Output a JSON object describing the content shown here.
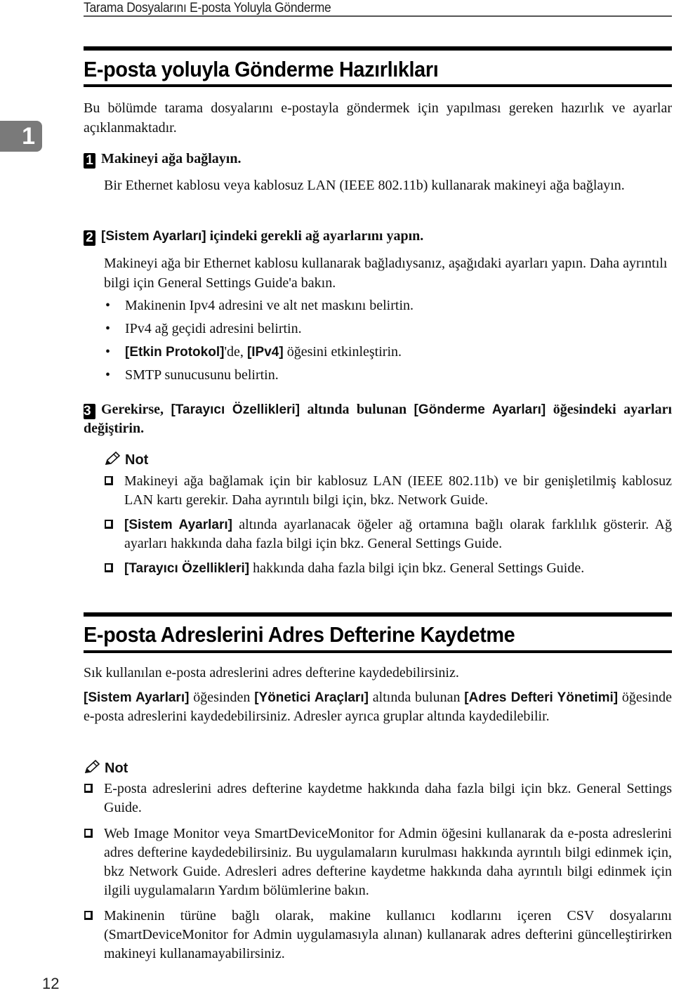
{
  "running_header": "Tarama Dosyalarını E-posta Yoluyla Gönderme",
  "chapter_tab": "1",
  "page_number": "12",
  "section1": {
    "title": "E-posta yoluyla Gönderme Hazırlıkları",
    "intro": "Bu bölümde tarama dosyalarını e-postayla göndermek için yapılması gereken hazırlık ve ayarlar açıklanmaktadır.",
    "steps": [
      {
        "number": "1",
        "heading": "Makineyi ağa bağlayın.",
        "body": "Bir Ethernet kablosu veya kablosuz LAN (IEEE 802.11b) kullanarak makineyi ağa bağlayın."
      },
      {
        "number": "2",
        "heading_key": "[Sistem Ayarları]",
        "heading_rest": " içindeki gerekli ağ ayarlarını yapın.",
        "body": "Makineyi ağa bir Ethernet kablosu kullanarak bağladıysanız, aşağıdaki ayarları yapın. Daha ayrıntılı bilgi için General Settings Guide'a bakın.",
        "bullets": [
          {
            "text": "Makinenin Ipv4 adresini ve alt net maskını belirtin."
          },
          {
            "text": "IPv4 ağ geçidi adresini belirtin."
          },
          {
            "key1": "[Etkin Protokol]",
            "mid": "'de, ",
            "key2": "[IPv4]",
            "rest": " öğesini etkinleştirin."
          },
          {
            "text": "SMTP sunucusunu belirtin."
          }
        ]
      },
      {
        "number": "3",
        "heading_pre": "Gerekirse, ",
        "heading_key1": "[Tarayıcı Özellikleri]",
        "heading_mid": " altında bulunan ",
        "heading_key2": "[Gönderme Ayarları]",
        "heading_rest": " öğesindeki ayarları değiştirin."
      }
    ],
    "note": {
      "title": "Not",
      "items": [
        {
          "text": "Makineyi ağa bağlamak için bir kablosuz LAN (IEEE 802.11b) ve bir genişletilmiş kablosuz LAN kartı gerekir. Daha ayrıntılı bilgi için, bkz. Network Guide."
        },
        {
          "key": "[Sistem Ayarları]",
          "text": " altında ayarlanacak öğeler ağ ortamına bağlı olarak farklılık gösterir. Ağ ayarları hakkında daha fazla bilgi için bkz. General Settings Guide."
        },
        {
          "key": "[Tarayıcı Özellikleri]",
          "text": " hakkında daha fazla bilgi için bkz. General Settings Guide."
        }
      ]
    }
  },
  "section2": {
    "title": "E-posta Adreslerini Adres Defterine Kaydetme",
    "intro": "Sık kullanılan e-posta adreslerini adres defterine kaydedebilirsiniz.",
    "para": {
      "key1": "[Sistem Ayarları]",
      "t1": " öğesinden ",
      "key2": "[Yönetici Araçları]",
      "t2": " altında bulunan ",
      "key3": "[Adres Defteri Yönetimi]",
      "t3": " öğesinde e-posta adreslerini kaydedebilirsiniz. Adresler ayrıca gruplar altında kaydedilebilir."
    },
    "note": {
      "title": "Not",
      "items": [
        {
          "text": "E-posta adreslerini adres defterine kaydetme hakkında daha fazla bilgi için bkz. General Settings Guide."
        },
        {
          "text": "Web Image Monitor veya SmartDeviceMonitor for Admin öğesini kullanarak da e-posta adreslerini adres defterine kaydedebilirsiniz. Bu uygulamaların kurulması hakkında ayrıntılı bilgi edinmek için, bkz Network Guide. Adresleri adres defterine kaydetme hakkında daha ayrıntılı bilgi edinmek için ilgili uygulamaların Yardım bölümlerine bakın."
        },
        {
          "text": "Makinenin türüne bağlı olarak, makine kullanıcı kodlarını içeren CSV dosyalarını (SmartDeviceMonitor for Admin uygulamasıyla alınan) kullanarak adres defterini güncelleştirirken makineyi kullanamayabilirsiniz."
        }
      ]
    }
  }
}
